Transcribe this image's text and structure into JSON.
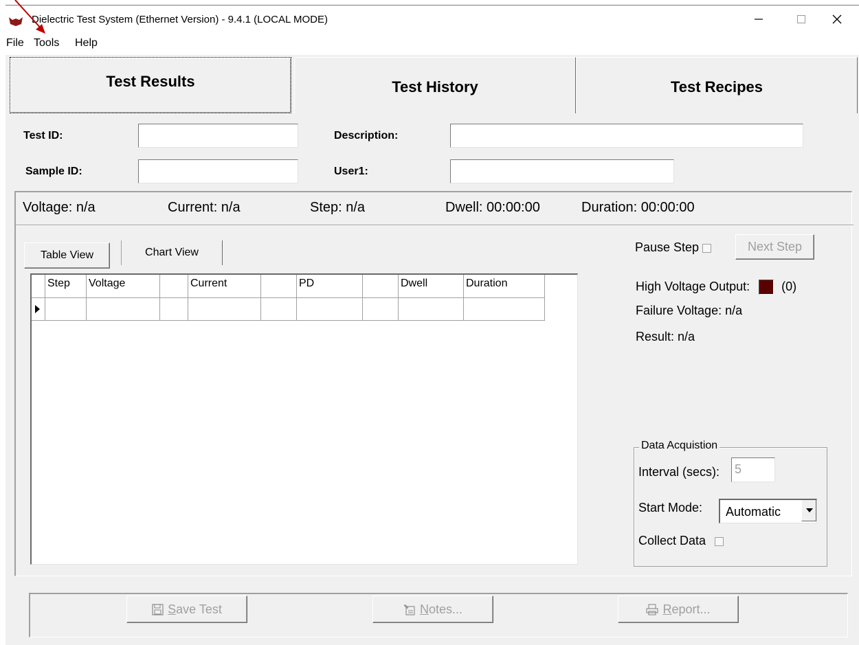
{
  "window": {
    "title": "Dielectric Test System (Ethernet Version) - 9.4.1  (LOCAL MODE)",
    "controls": {
      "minimize": "—",
      "maximize": "☐",
      "close": "✕"
    }
  },
  "menu": {
    "file": "File",
    "tools": "Tools",
    "help": "Help"
  },
  "tabs": {
    "results": "Test Results",
    "history": "Test History",
    "recipes": "Test Recipes"
  },
  "form": {
    "test_id_label": "Test ID:",
    "test_id_value": "",
    "description_label": "Description:",
    "description_value": "",
    "sample_id_label": "Sample ID:",
    "sample_id_value": "",
    "user1_label": "User1:",
    "user1_value": ""
  },
  "status": {
    "voltage": "Voltage: n/a",
    "current": "Current: n/a",
    "step": "Step: n/a",
    "dwell": "Dwell: 00:00:00",
    "duration": "Duration:  00:00:00"
  },
  "view_tabs": {
    "table": "Table View",
    "chart": "Chart View"
  },
  "grid": {
    "columns": [
      "Step",
      "Voltage",
      "",
      "Current",
      "",
      "PD",
      "",
      "Dwell",
      "Duration"
    ]
  },
  "controls": {
    "pause_step": "Pause Step",
    "next_step": "Next Step",
    "high_voltage_output": "High Voltage Output:",
    "high_voltage_count": "(0)",
    "led_color": "#5a0000",
    "failure_voltage": "Failure Voltage: n/a",
    "result": "Result:  n/a"
  },
  "data_acquisition": {
    "title": "Data Acquistion",
    "interval_label": "Interval (secs):",
    "interval_value": "5",
    "start_mode_label": "Start Mode:",
    "start_mode_value": "Automatic",
    "collect_data": "Collect Data"
  },
  "buttons": {
    "save_prefix": "S",
    "save_rest": "ave Test",
    "notes_prefix": "N",
    "notes_rest": "otes...",
    "report_prefix": "R",
    "report_rest": "eport..."
  }
}
